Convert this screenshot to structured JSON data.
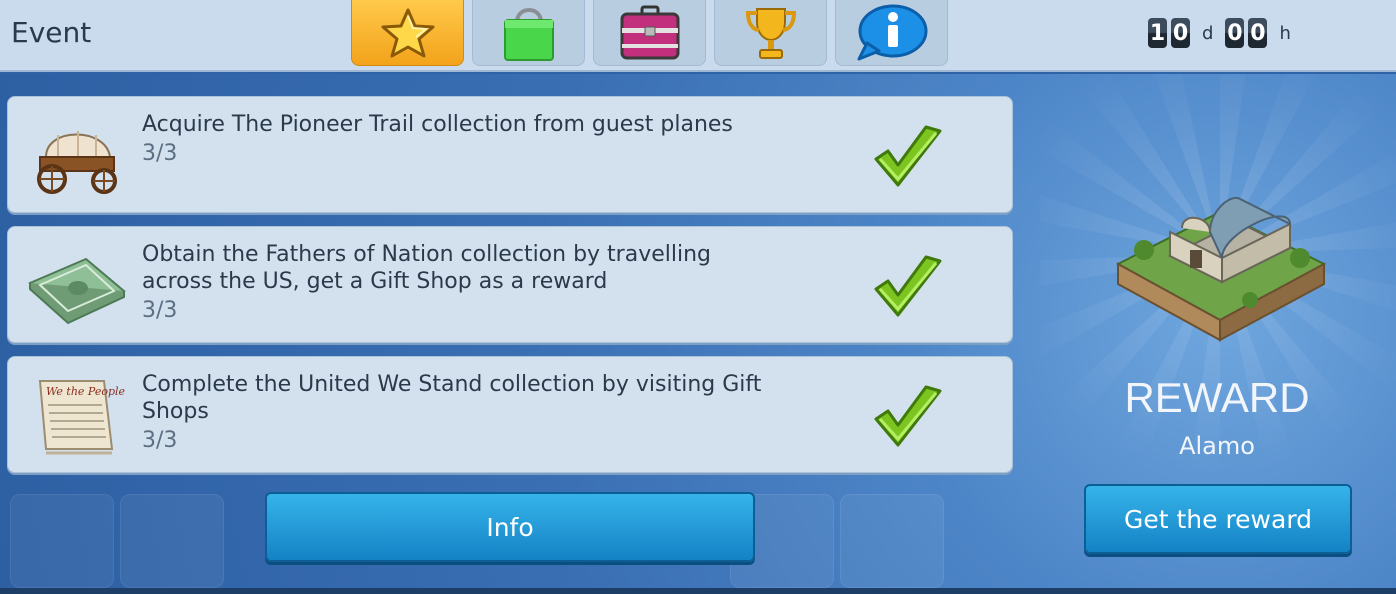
{
  "header": {
    "title": "Event",
    "tabs": [
      {
        "icon": "star-icon",
        "active": true
      },
      {
        "icon": "shopping-bag-icon",
        "active": false
      },
      {
        "icon": "suitcase-icon",
        "active": false
      },
      {
        "icon": "trophy-icon",
        "active": false
      },
      {
        "icon": "info-bubble-icon",
        "active": false
      }
    ],
    "timer": {
      "days_digits": [
        "1",
        "0"
      ],
      "days_unit": "d",
      "hours_digits": [
        "0",
        "0"
      ],
      "hours_unit": "h"
    }
  },
  "tasks": [
    {
      "description": "Acquire The Pioneer Trail collection from guest planes",
      "progress": "3/3",
      "icon": "covered-wagon-icon",
      "completed": true
    },
    {
      "description": "Obtain the Fathers of Nation collection by travelling across the US, get a Gift Shop as a reward",
      "progress": "3/3",
      "icon": "banknote-stack-icon",
      "completed": true
    },
    {
      "description": "Complete the United We Stand collection by visiting Gift Shops",
      "progress": "3/3",
      "icon": "constitution-document-icon",
      "completed": true
    }
  ],
  "info_button": "Info",
  "reward": {
    "title": "REWARD",
    "name": "Alamo",
    "button": "Get the reward",
    "image_icon": "alamo-building-icon"
  },
  "document_icon_text": "We the People",
  "colors": {
    "header_bg": "#c9dbec",
    "active_tab": "#f3a31b",
    "panel_bg": "#2f63a8",
    "task_card": "#d3e1ef",
    "button": "#1e95d6",
    "check_green": "#7cc41f"
  }
}
